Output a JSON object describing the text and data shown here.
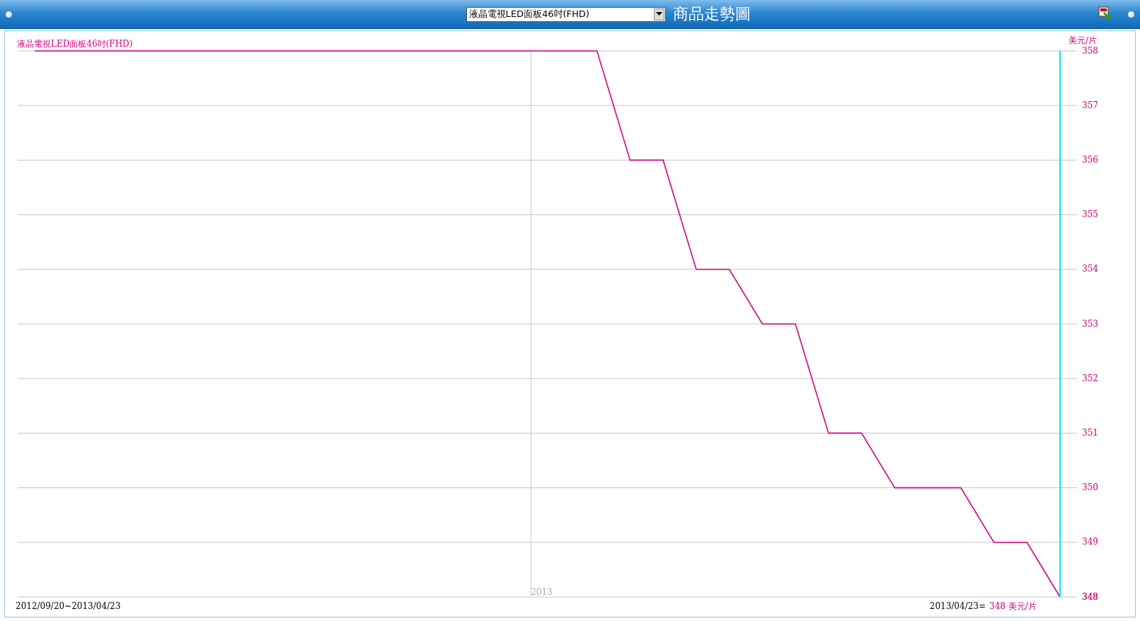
{
  "header": {
    "product_select": {
      "value": "液晶電視LED面板46吋(FHD)"
    },
    "title": "商品走勢圖"
  },
  "chart": {
    "chart_data": {
      "type": "line",
      "grid": true,
      "ylim": [
        348,
        358
      ],
      "yticks": [
        348,
        349,
        350,
        351,
        352,
        353,
        354,
        355,
        356,
        357,
        358
      ],
      "ylabel": "美元/片",
      "categories": [
        null,
        null,
        null,
        null,
        null,
        null,
        null,
        null,
        null,
        null,
        null,
        null,
        null,
        null,
        null,
        "2013",
        null,
        null,
        null,
        null,
        null,
        null,
        null,
        null,
        null,
        null,
        null,
        null,
        null,
        null,
        null,
        null
      ],
      "series": [
        {
          "name": "液晶電視LED面板46吋(FHD)",
          "color": "#d6007f",
          "values": [
            358,
            358,
            358,
            358,
            358,
            358,
            358,
            358,
            358,
            358,
            358,
            358,
            358,
            358,
            358,
            358,
            358,
            358,
            356,
            356,
            354,
            354,
            353,
            353,
            351,
            351,
            350,
            350,
            350,
            349,
            349,
            348
          ]
        }
      ]
    },
    "date_range": "2012/09/20~2013/04/23",
    "cursor": {
      "date": "2013/04/23=",
      "value": "348",
      "unit": "美元/片",
      "axis_value": "348"
    }
  }
}
